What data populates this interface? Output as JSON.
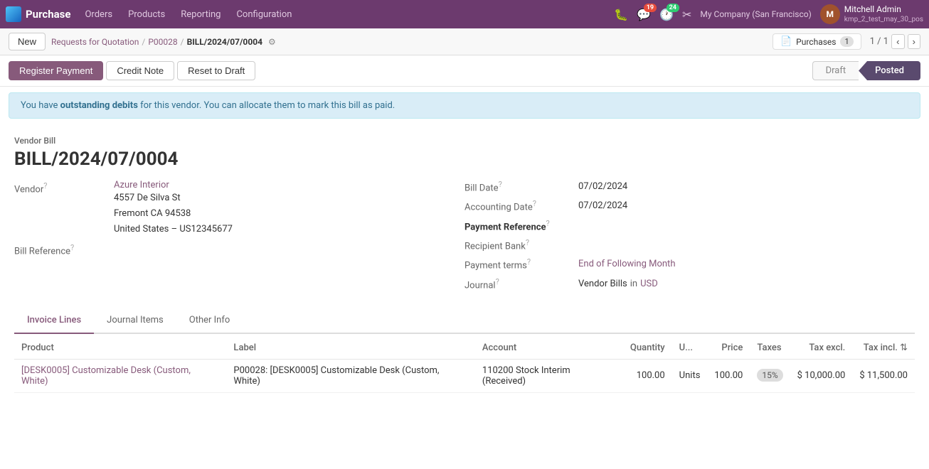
{
  "app": {
    "brand": "Purchase",
    "nav_links": [
      "Orders",
      "Products",
      "Reporting",
      "Configuration"
    ]
  },
  "topbar": {
    "bug_icon": "🐛",
    "message_badge": "19",
    "activity_badge": "24",
    "tools_icon": "⚙",
    "company": "My Company (San Francisco)",
    "user_name": "Mitchell Admin",
    "user_subtitle": "kmp_2_test_may_30_pos"
  },
  "breadcrumb": {
    "new_label": "New",
    "parent_link": "Requests for Quotation",
    "parent_link2": "P00028",
    "current": "BILL/2024/07/0004",
    "purchases_label": "Purchases",
    "purchases_count": "1",
    "pagination": "1 / 1"
  },
  "actions": {
    "register_payment": "Register Payment",
    "credit_note": "Credit Note",
    "reset_to_draft": "Reset to Draft",
    "status_draft": "Draft",
    "status_posted": "Posted"
  },
  "alert": {
    "text_start": "You have ",
    "text_bold": "outstanding debits",
    "text_end": " for this vendor. You can allocate them to mark this bill as paid."
  },
  "form": {
    "form_label": "Vendor Bill",
    "bill_number": "BILL/2024/07/0004",
    "vendor_label": "Vendor",
    "vendor_name": "Azure Interior",
    "vendor_address_line1": "4557 De Silva St",
    "vendor_address_line2": "Fremont CA 94538",
    "vendor_address_line3": "United States – US12345677",
    "bill_reference_label": "Bill Reference",
    "bill_date_label": "Bill Date",
    "bill_date_value": "07/02/2024",
    "accounting_date_label": "Accounting Date",
    "accounting_date_value": "07/02/2024",
    "payment_reference_label": "Payment Reference",
    "payment_reference_value": "",
    "recipient_bank_label": "Recipient Bank",
    "recipient_bank_value": "",
    "payment_terms_label": "Payment terms",
    "payment_terms_value": "End of Following Month",
    "journal_label": "Journal",
    "journal_value": "Vendor Bills",
    "journal_in": "in",
    "journal_currency": "USD"
  },
  "tabs": [
    {
      "id": "invoice-lines",
      "label": "Invoice Lines",
      "active": true
    },
    {
      "id": "journal-items",
      "label": "Journal Items",
      "active": false
    },
    {
      "id": "other-info",
      "label": "Other Info",
      "active": false
    }
  ],
  "table": {
    "columns": [
      {
        "id": "product",
        "label": "Product"
      },
      {
        "id": "label",
        "label": "Label"
      },
      {
        "id": "account",
        "label": "Account"
      },
      {
        "id": "quantity",
        "label": "Quantity",
        "align": "right"
      },
      {
        "id": "unit",
        "label": "U..."
      },
      {
        "id": "price",
        "label": "Price",
        "align": "right"
      },
      {
        "id": "taxes",
        "label": "Taxes"
      },
      {
        "id": "tax_excl",
        "label": "Tax excl.",
        "align": "right"
      },
      {
        "id": "tax_incl",
        "label": "Tax incl.",
        "align": "right"
      }
    ],
    "rows": [
      {
        "product": "[DESK0005] Customizable Desk (Custom, White)",
        "label": "P00028: [DESK0005] Customizable Desk (Custom, White)",
        "account": "110200 Stock Interim (Received)",
        "quantity": "100.00",
        "unit": "Units",
        "price": "100.00",
        "taxes": "15%",
        "tax_excl": "$ 10,000.00",
        "tax_incl": "$ 11,500.00"
      }
    ]
  }
}
